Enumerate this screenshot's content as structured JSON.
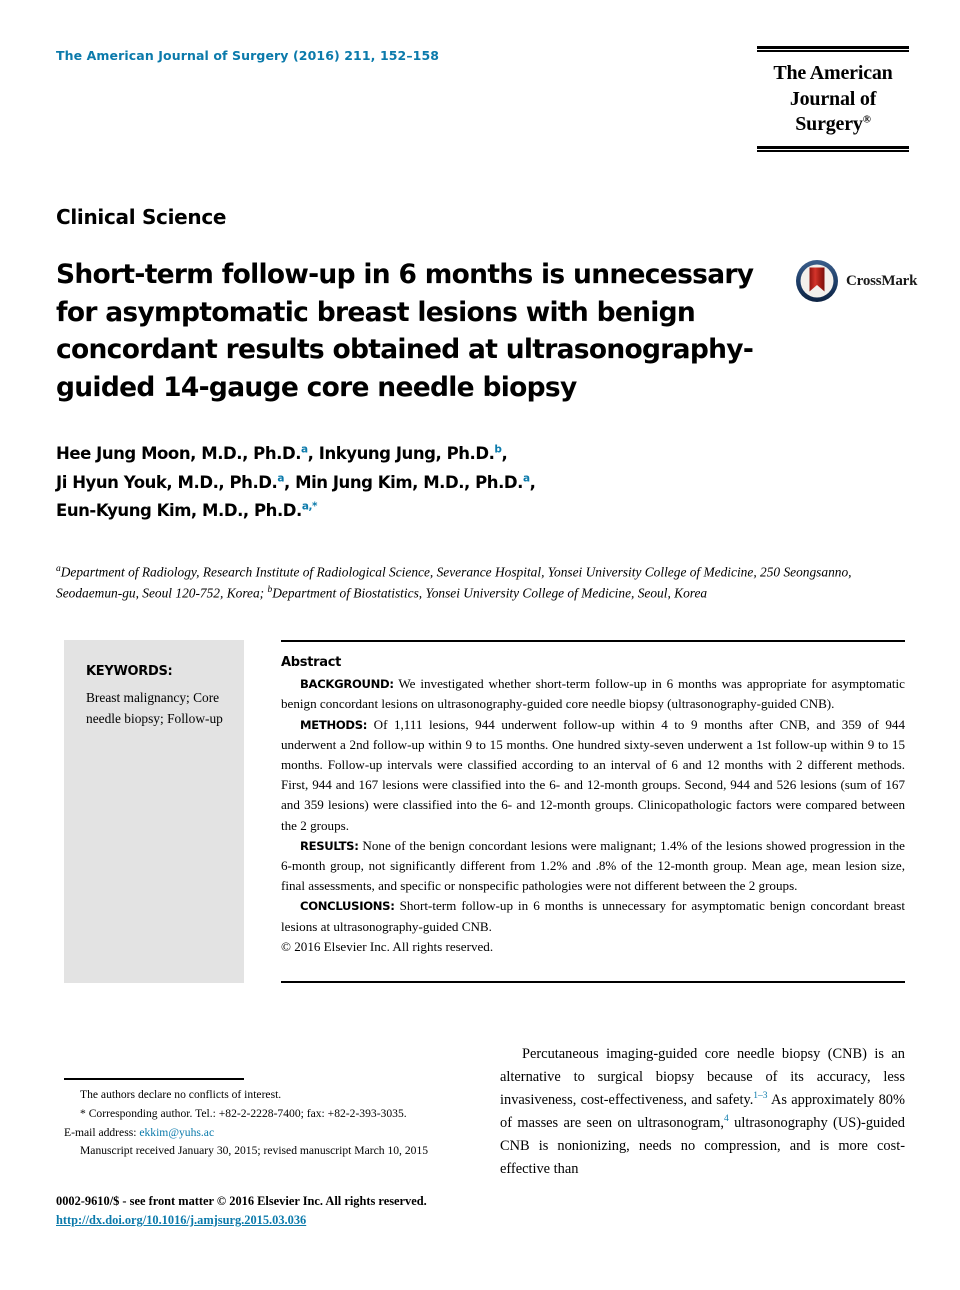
{
  "header": {
    "masthead": "The American Journal of Surgery (2016) 211, 152–158",
    "journal_logo_line1": "The American",
    "journal_logo_line2": "Journal of Surgery"
  },
  "colors": {
    "accent_blue": "#0b7aab",
    "keyword_box": "#e3e3e3",
    "crossmark_ring": "#1c3c66",
    "crossmark_ribbon": "#b32118"
  },
  "article": {
    "kicker": "Clinical Science",
    "title": "Short-term follow-up in 6 months is unnecessary for asymptomatic breast lesions with benign concordant results obtained at ultrasonography-guided 14-gauge core needle biopsy",
    "crossmark_label": "CrossMark",
    "authors_line1_a": "Hee Jung Moon, M.D., Ph.D.",
    "authors_line1_a_sup": "a",
    "authors_line1_b": ", Inkyung Jung, Ph.D.",
    "authors_line1_b_sup": "b",
    "authors_line1_end": ",",
    "authors_line2_a": "Ji Hyun Youk, M.D., Ph.D.",
    "authors_line2_a_sup": "a",
    "authors_line2_b": ", Min Jung Kim, M.D., Ph.D.",
    "authors_line2_b_sup": "a",
    "authors_line2_end": ",",
    "authors_line3_a": "Eun-Kyung Kim, M.D., Ph.D.",
    "authors_line3_a_sup": "a,*",
    "affiliation_sup_a": "a",
    "affiliation_a": "Department of Radiology, Research Institute of Radiological Science, Severance Hospital, Yonsei University College of Medicine, 250 Seongsanno, Seodaemun-gu, Seoul 120-752, Korea; ",
    "affiliation_sup_b": "b",
    "affiliation_b": "Department of Biostatistics, Yonsei University College of Medicine, Seoul, Korea"
  },
  "keywords": {
    "heading": "KEYWORDS:",
    "items": "Breast malignancy; Core needle biopsy; Follow-up"
  },
  "abstract": {
    "heading": "Abstract",
    "background_label": "BACKGROUND:",
    "background_text": " We investigated whether short-term follow-up in 6 months was appropriate for asymptomatic benign concordant lesions on ultrasonography-guided core needle biopsy (ultrasonography-guided CNB).",
    "methods_label": "METHODS:",
    "methods_text": " Of 1,111 lesions, 944 underwent follow-up within 4 to 9 months after CNB, and 359 of 944 underwent a 2nd follow-up within 9 to 15 months. One hundred sixty-seven underwent a 1st follow-up within 9 to 15 months. Follow-up intervals were classified according to an interval of 6 and 12 months with 2 different methods. First, 944 and 167 lesions were classified into the 6- and 12-month groups. Second, 944 and 526 lesions (sum of 167 and 359 lesions) were classified into the 6- and 12-month groups. Clinicopathologic factors were compared between the 2 groups.",
    "results_label": "RESULTS:",
    "results_text": " None of the benign concordant lesions were malignant; 1.4% of the lesions showed progression in the 6-month group, not significantly different from 1.2% and .8% of the 12-month group. Mean age, mean lesion size, final assessments, and specific or nonspecific pathologies were not different between the 2 groups.",
    "conclusions_label": "CONCLUSIONS:",
    "conclusions_text": "  Short-term follow-up in 6 months is unnecessary for asymptomatic benign concordant breast lesions at ultrasonography-guided CNB.",
    "copyright": "© 2016 Elsevier Inc. All rights reserved."
  },
  "footnotes": {
    "conflicts": "The authors declare no conflicts of interest.",
    "corresponding": "* Corresponding author. Tel.: +82-2-2228-7400; fax: +82-2-393-3035.",
    "email_label": "E-mail address: ",
    "email": "ekkim@yuhs.ac",
    "manuscript": "Manuscript received January 30, 2015; revised manuscript March 10, 2015"
  },
  "body": {
    "paragraph_1a": "Percutaneous imaging-guided core needle biopsy (CNB) is an alternative to surgical biopsy because of its accuracy, less invasiveness, cost-effectiveness, and safety.",
    "citation_1": "1–3",
    "paragraph_1b": " As approximately 80% of masses are seen on ultrasonogram,",
    "citation_2": "4",
    "paragraph_1c": " ultrasonography (US)-guided CNB is nonionizing, needs no compression, and is more cost-effective than"
  },
  "footer": {
    "issn_line": "0002-9610/$ - see front matter © 2016 Elsevier Inc. All rights reserved.",
    "doi": "http://dx.doi.org/10.1016/j.amjsurg.2015.03.036"
  }
}
